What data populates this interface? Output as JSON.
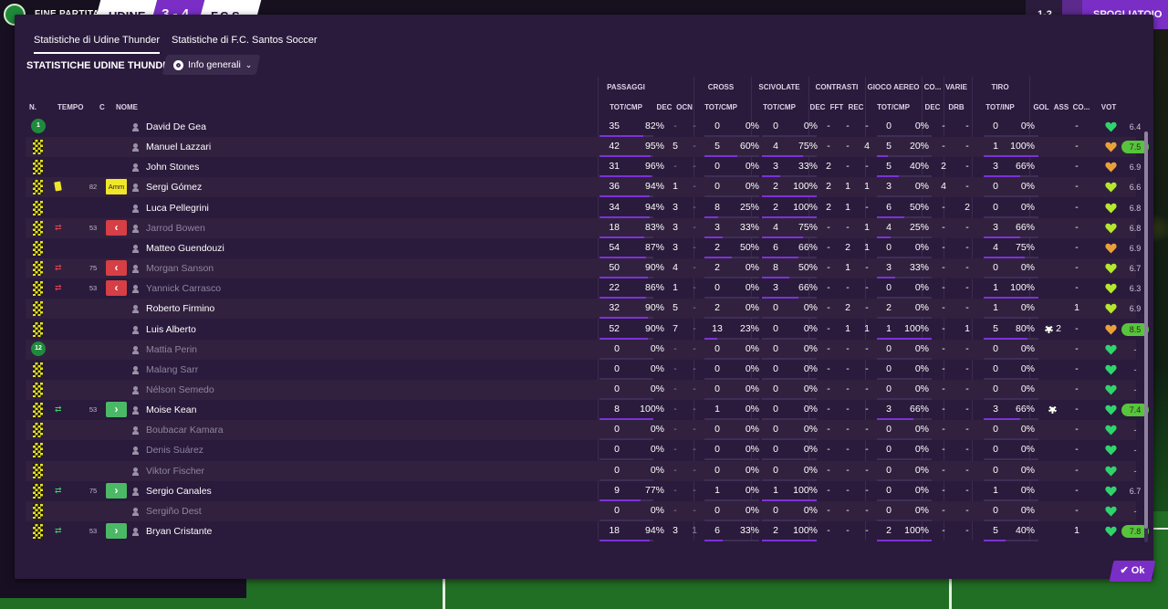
{
  "topbar": {
    "title": "FINE PARTITA",
    "home_team": "UDINE",
    "score": "3 - 4",
    "away_team": "F.C.S",
    "right_small": "1-2",
    "right_chev": "⌄",
    "right_label": "SPOGLIATOIO"
  },
  "tabs": [
    "Statistiche di Udine Thunder",
    "Statistiche di F.C. Santos Soccer"
  ],
  "section_title": "STATISTICHE UDINE THUNDER",
  "filter": {
    "label": "Info generali",
    "icon": "eye-icon"
  },
  "group_headers": {
    "passaggi": "PASSAGGI",
    "cross": "CROSS",
    "scivolate": "SCIVOLATE",
    "contrasti": "CONTRASTI",
    "gioco_aereo": "GIOCO AEREO",
    "co": "CO...",
    "varie": "VARIE",
    "tiro": "TIRO"
  },
  "col_headers": {
    "n": "N.",
    "tempo": "TEMPO",
    "c": "C",
    "nome": "NOME",
    "pass_totcmp": "TOT/CMP",
    "pass_dec": "DEC",
    "pass_ocn": "OCN",
    "cross_totcmp": "TOT/CMP",
    "sciv_totcmp": "TOT/CMP",
    "con_dec": "DEC",
    "con_fft": "FFT",
    "con_rec": "REC",
    "aereo_totcmp": "TOT/CMP",
    "co_dec": "DEC",
    "varie_drb": "DRB",
    "tiro_totinp": "TOT/INP",
    "gol": "GOL",
    "ass": "ASS",
    "cond": "CO...",
    "vot": "VOT"
  },
  "players": [
    {
      "n": "1",
      "name": "David De Gea",
      "kind": "gk",
      "dim": false,
      "min": "",
      "c": "",
      "pa": "35",
      "pp": "82%",
      "pd": "-",
      "po": "-",
      "ca": "0",
      "cp": "0%",
      "sa": "0",
      "sp": "0%",
      "d1": "-",
      "d2": "-",
      "d3": "-",
      "aa": "0",
      "ap": "0%",
      "cd": "-",
      "dr": "-",
      "ta": "0",
      "tp": "0%",
      "gol": "",
      "ass": "-",
      "cond": "green",
      "vot": "6.4",
      "hi": false
    },
    {
      "n": "",
      "name": "Manuel Lazzari",
      "kind": "",
      "dim": false,
      "min": "",
      "c": "",
      "pa": "42",
      "pp": "95%",
      "pd": "5",
      "po": "-",
      "ca": "5",
      "cp": "60%",
      "sa": "4",
      "sp": "75%",
      "d1": "-",
      "d2": "-",
      "d3": "4",
      "aa": "5",
      "ap": "20%",
      "cd": "-",
      "dr": "-",
      "ta": "1",
      "tp": "100%",
      "gol": "",
      "ass": "-",
      "cond": "orange",
      "vot": "7.5",
      "hi": true
    },
    {
      "n": "",
      "name": "John Stones",
      "kind": "",
      "dim": false,
      "min": "",
      "c": "",
      "pa": "31",
      "pp": "96%",
      "pd": "-",
      "po": "-",
      "ca": "0",
      "cp": "0%",
      "sa": "3",
      "sp": "33%",
      "d1": "2",
      "d2": "-",
      "d3": "-",
      "aa": "5",
      "ap": "40%",
      "cd": "2",
      "dr": "-",
      "ta": "3",
      "tp": "66%",
      "gol": "",
      "ass": "-",
      "cond": "orange",
      "vot": "6.9",
      "hi": false
    },
    {
      "n": "",
      "name": "Sergi Gómez",
      "kind": "yellow",
      "dim": false,
      "min": "82",
      "c": "Amm",
      "pa": "36",
      "pp": "94%",
      "pd": "1",
      "po": "-",
      "ca": "0",
      "cp": "0%",
      "sa": "2",
      "sp": "100%",
      "d1": "2",
      "d2": "1",
      "d3": "1",
      "aa": "3",
      "ap": "0%",
      "cd": "4",
      "dr": "-",
      "ta": "0",
      "tp": "0%",
      "gol": "",
      "ass": "-",
      "cond": "lime",
      "vot": "6.6",
      "hi": false
    },
    {
      "n": "",
      "name": "Luca Pellegrini",
      "kind": "",
      "dim": false,
      "min": "",
      "c": "",
      "pa": "34",
      "pp": "94%",
      "pd": "3",
      "po": "-",
      "ca": "8",
      "cp": "25%",
      "sa": "2",
      "sp": "100%",
      "d1": "2",
      "d2": "1",
      "d3": "-",
      "aa": "6",
      "ap": "50%",
      "cd": "-",
      "dr": "2",
      "ta": "0",
      "tp": "0%",
      "gol": "",
      "ass": "-",
      "cond": "lime",
      "vot": "6.8",
      "hi": false
    },
    {
      "n": "",
      "name": "Jarrod Bowen",
      "kind": "out",
      "dim": true,
      "min": "53",
      "c": "",
      "pa": "18",
      "pp": "83%",
      "pd": "3",
      "po": "-",
      "ca": "3",
      "cp": "33%",
      "sa": "4",
      "sp": "75%",
      "d1": "-",
      "d2": "-",
      "d3": "1",
      "aa": "4",
      "ap": "25%",
      "cd": "-",
      "dr": "-",
      "ta": "3",
      "tp": "66%",
      "gol": "",
      "ass": "-",
      "cond": "lime",
      "vot": "6.8",
      "hi": false
    },
    {
      "n": "",
      "name": "Matteo Guendouzi",
      "kind": "",
      "dim": false,
      "min": "",
      "c": "",
      "pa": "54",
      "pp": "87%",
      "pd": "3",
      "po": "-",
      "ca": "2",
      "cp": "50%",
      "sa": "6",
      "sp": "66%",
      "d1": "-",
      "d2": "2",
      "d3": "1",
      "aa": "0",
      "ap": "0%",
      "cd": "-",
      "dr": "-",
      "ta": "4",
      "tp": "75%",
      "gol": "",
      "ass": "-",
      "cond": "orange",
      "vot": "6.9",
      "hi": false
    },
    {
      "n": "",
      "name": "Morgan Sanson",
      "kind": "out",
      "dim": true,
      "min": "75",
      "c": "",
      "pa": "50",
      "pp": "90%",
      "pd": "4",
      "po": "-",
      "ca": "2",
      "cp": "0%",
      "sa": "8",
      "sp": "50%",
      "d1": "-",
      "d2": "1",
      "d3": "-",
      "aa": "3",
      "ap": "33%",
      "cd": "-",
      "dr": "-",
      "ta": "0",
      "tp": "0%",
      "gol": "",
      "ass": "-",
      "cond": "lime",
      "vot": "6.7",
      "hi": false
    },
    {
      "n": "",
      "name": "Yannick Carrasco",
      "kind": "out",
      "dim": true,
      "min": "53",
      "c": "",
      "pa": "22",
      "pp": "86%",
      "pd": "1",
      "po": "-",
      "ca": "0",
      "cp": "0%",
      "sa": "3",
      "sp": "66%",
      "d1": "-",
      "d2": "-",
      "d3": "-",
      "aa": "0",
      "ap": "0%",
      "cd": "-",
      "dr": "-",
      "ta": "1",
      "tp": "100%",
      "gol": "",
      "ass": "-",
      "cond": "lime",
      "vot": "6.3",
      "hi": false
    },
    {
      "n": "",
      "name": "Roberto Firmino",
      "kind": "",
      "dim": false,
      "min": "",
      "c": "",
      "pa": "32",
      "pp": "90%",
      "pd": "5",
      "po": "-",
      "ca": "2",
      "cp": "0%",
      "sa": "0",
      "sp": "0%",
      "d1": "-",
      "d2": "2",
      "d3": "-",
      "aa": "2",
      "ap": "0%",
      "cd": "-",
      "dr": "-",
      "ta": "1",
      "tp": "0%",
      "gol": "",
      "ass": "1",
      "cond": "lime",
      "vot": "6.9",
      "hi": false
    },
    {
      "n": "",
      "name": "Luis Alberto",
      "kind": "",
      "dim": false,
      "min": "",
      "c": "",
      "pa": "52",
      "pp": "90%",
      "pd": "7",
      "po": "-",
      "ca": "13",
      "cp": "23%",
      "sa": "0",
      "sp": "0%",
      "d1": "-",
      "d2": "1",
      "d3": "1",
      "aa": "1",
      "ap": "100%",
      "cd": "-",
      "dr": "1",
      "ta": "5",
      "tp": "80%",
      "gol": "2",
      "ass": "-",
      "cond": "orange",
      "vot": "8.5",
      "hi": true
    },
    {
      "n": "12",
      "name": "Mattia Perin",
      "kind": "gk",
      "dim": true,
      "min": "",
      "c": "",
      "pa": "0",
      "pp": "0%",
      "pd": "-",
      "po": "-",
      "ca": "0",
      "cp": "0%",
      "sa": "0",
      "sp": "0%",
      "d1": "-",
      "d2": "-",
      "d3": "-",
      "aa": "0",
      "ap": "0%",
      "cd": "-",
      "dr": "-",
      "ta": "0",
      "tp": "0%",
      "gol": "",
      "ass": "-",
      "cond": "green",
      "vot": "-",
      "hi": false
    },
    {
      "n": "",
      "name": "Malang Sarr",
      "kind": "",
      "dim": true,
      "min": "",
      "c": "",
      "pa": "0",
      "pp": "0%",
      "pd": "-",
      "po": "-",
      "ca": "0",
      "cp": "0%",
      "sa": "0",
      "sp": "0%",
      "d1": "-",
      "d2": "-",
      "d3": "-",
      "aa": "0",
      "ap": "0%",
      "cd": "-",
      "dr": "-",
      "ta": "0",
      "tp": "0%",
      "gol": "",
      "ass": "-",
      "cond": "green",
      "vot": "-",
      "hi": false
    },
    {
      "n": "",
      "name": "Nélson Semedo",
      "kind": "",
      "dim": true,
      "min": "",
      "c": "",
      "pa": "0",
      "pp": "0%",
      "pd": "-",
      "po": "-",
      "ca": "0",
      "cp": "0%",
      "sa": "0",
      "sp": "0%",
      "d1": "-",
      "d2": "-",
      "d3": "-",
      "aa": "0",
      "ap": "0%",
      "cd": "-",
      "dr": "-",
      "ta": "0",
      "tp": "0%",
      "gol": "",
      "ass": "-",
      "cond": "green",
      "vot": "-",
      "hi": false
    },
    {
      "n": "",
      "name": "Moise Kean",
      "kind": "in",
      "dim": false,
      "min": "53",
      "c": "",
      "pa": "8",
      "pp": "100%",
      "pd": "-",
      "po": "-",
      "ca": "1",
      "cp": "0%",
      "sa": "0",
      "sp": "0%",
      "d1": "-",
      "d2": "-",
      "d3": "-",
      "aa": "3",
      "ap": "66%",
      "cd": "-",
      "dr": "-",
      "ta": "3",
      "tp": "66%",
      "gol": "ball",
      "ass": "-",
      "cond": "green",
      "vot": "7.4",
      "hi": true
    },
    {
      "n": "",
      "name": "Boubacar Kamara",
      "kind": "",
      "dim": true,
      "min": "",
      "c": "",
      "pa": "0",
      "pp": "0%",
      "pd": "-",
      "po": "-",
      "ca": "0",
      "cp": "0%",
      "sa": "0",
      "sp": "0%",
      "d1": "-",
      "d2": "-",
      "d3": "-",
      "aa": "0",
      "ap": "0%",
      "cd": "-",
      "dr": "-",
      "ta": "0",
      "tp": "0%",
      "gol": "",
      "ass": "-",
      "cond": "green",
      "vot": "-",
      "hi": false
    },
    {
      "n": "",
      "name": "Denis Suárez",
      "kind": "",
      "dim": true,
      "min": "",
      "c": "",
      "pa": "0",
      "pp": "0%",
      "pd": "-",
      "po": "-",
      "ca": "0",
      "cp": "0%",
      "sa": "0",
      "sp": "0%",
      "d1": "-",
      "d2": "-",
      "d3": "-",
      "aa": "0",
      "ap": "0%",
      "cd": "-",
      "dr": "-",
      "ta": "0",
      "tp": "0%",
      "gol": "",
      "ass": "-",
      "cond": "green",
      "vot": "-",
      "hi": false
    },
    {
      "n": "",
      "name": "Viktor Fischer",
      "kind": "",
      "dim": true,
      "min": "",
      "c": "",
      "pa": "0",
      "pp": "0%",
      "pd": "-",
      "po": "-",
      "ca": "0",
      "cp": "0%",
      "sa": "0",
      "sp": "0%",
      "d1": "-",
      "d2": "-",
      "d3": "-",
      "aa": "0",
      "ap": "0%",
      "cd": "-",
      "dr": "-",
      "ta": "0",
      "tp": "0%",
      "gol": "",
      "ass": "-",
      "cond": "green",
      "vot": "-",
      "hi": false
    },
    {
      "n": "",
      "name": "Sergio Canales",
      "kind": "in",
      "dim": false,
      "min": "75",
      "c": "",
      "pa": "9",
      "pp": "77%",
      "pd": "-",
      "po": "-",
      "ca": "1",
      "cp": "0%",
      "sa": "1",
      "sp": "100%",
      "d1": "-",
      "d2": "-",
      "d3": "-",
      "aa": "0",
      "ap": "0%",
      "cd": "-",
      "dr": "-",
      "ta": "1",
      "tp": "0%",
      "gol": "",
      "ass": "-",
      "cond": "green",
      "vot": "6.7",
      "hi": false
    },
    {
      "n": "",
      "name": "Sergiño Dest",
      "kind": "",
      "dim": true,
      "min": "",
      "c": "",
      "pa": "0",
      "pp": "0%",
      "pd": "-",
      "po": "-",
      "ca": "0",
      "cp": "0%",
      "sa": "0",
      "sp": "0%",
      "d1": "-",
      "d2": "-",
      "d3": "-",
      "aa": "0",
      "ap": "0%",
      "cd": "-",
      "dr": "-",
      "ta": "0",
      "tp": "0%",
      "gol": "",
      "ass": "-",
      "cond": "green",
      "vot": "-",
      "hi": false
    },
    {
      "n": "",
      "name": "Bryan Cristante",
      "kind": "in",
      "dim": false,
      "min": "53",
      "c": "",
      "pa": "18",
      "pp": "94%",
      "pd": "3",
      "po": "1",
      "ca": "6",
      "cp": "33%",
      "sa": "2",
      "sp": "100%",
      "d1": "-",
      "d2": "-",
      "d3": "-",
      "aa": "2",
      "ap": "100%",
      "cd": "-",
      "dr": "-",
      "ta": "5",
      "tp": "40%",
      "gol": "",
      "ass": "1",
      "cond": "green",
      "vot": "7.8",
      "hi": true
    }
  ],
  "ok_label": "Ok",
  "colors": {
    "accent": "#7a2ec6",
    "panel": "#2a1a3c",
    "green_badge": "#1f8a3c",
    "high_rating": "#57c43c",
    "card_yellow": "#f0e62a",
    "sub_out": "#d53f45",
    "sub_in": "#4bb865"
  }
}
